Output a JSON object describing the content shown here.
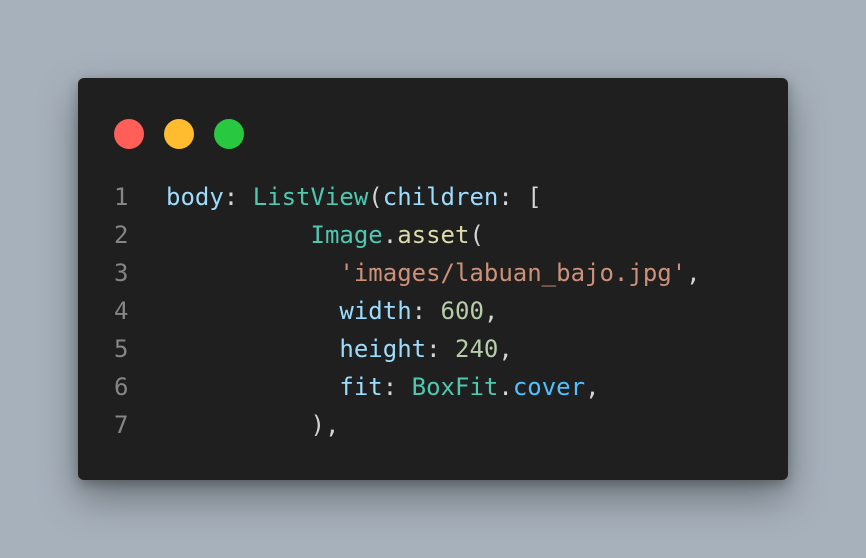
{
  "window": {
    "traffic_lights": [
      {
        "name": "close",
        "color": "#ff5f57"
      },
      {
        "name": "minimize",
        "color": "#febc2e"
      },
      {
        "name": "maximize",
        "color": "#28c840"
      }
    ]
  },
  "code": {
    "lines": [
      {
        "number": "1",
        "indent": "",
        "tokens": [
          {
            "t": "body",
            "c": "prop"
          },
          {
            "t": ": ",
            "c": "punc"
          },
          {
            "t": "ListView",
            "c": "class"
          },
          {
            "t": "(",
            "c": "punc"
          },
          {
            "t": "children",
            "c": "prop"
          },
          {
            "t": ": [",
            "c": "punc"
          }
        ]
      },
      {
        "number": "2",
        "indent": "          ",
        "tokens": [
          {
            "t": "Image",
            "c": "class"
          },
          {
            "t": ".",
            "c": "punc"
          },
          {
            "t": "asset",
            "c": "func"
          },
          {
            "t": "(",
            "c": "punc"
          }
        ]
      },
      {
        "number": "3",
        "indent": "            ",
        "tokens": [
          {
            "t": "'images/labuan_bajo.jpg'",
            "c": "str"
          },
          {
            "t": ",",
            "c": "punc"
          }
        ]
      },
      {
        "number": "4",
        "indent": "            ",
        "tokens": [
          {
            "t": "width",
            "c": "prop"
          },
          {
            "t": ": ",
            "c": "punc"
          },
          {
            "t": "600",
            "c": "num"
          },
          {
            "t": ",",
            "c": "punc"
          }
        ]
      },
      {
        "number": "5",
        "indent": "            ",
        "tokens": [
          {
            "t": "height",
            "c": "prop"
          },
          {
            "t": ": ",
            "c": "punc"
          },
          {
            "t": "240",
            "c": "num"
          },
          {
            "t": ",",
            "c": "punc"
          }
        ]
      },
      {
        "number": "6",
        "indent": "            ",
        "tokens": [
          {
            "t": "fit",
            "c": "prop"
          },
          {
            "t": ": ",
            "c": "punc"
          },
          {
            "t": "BoxFit",
            "c": "class"
          },
          {
            "t": ".",
            "c": "punc"
          },
          {
            "t": "cover",
            "c": "member"
          },
          {
            "t": ",",
            "c": "punc"
          }
        ]
      },
      {
        "number": "7",
        "indent": "          ",
        "tokens": [
          {
            "t": "),",
            "c": "punc"
          }
        ]
      }
    ]
  }
}
